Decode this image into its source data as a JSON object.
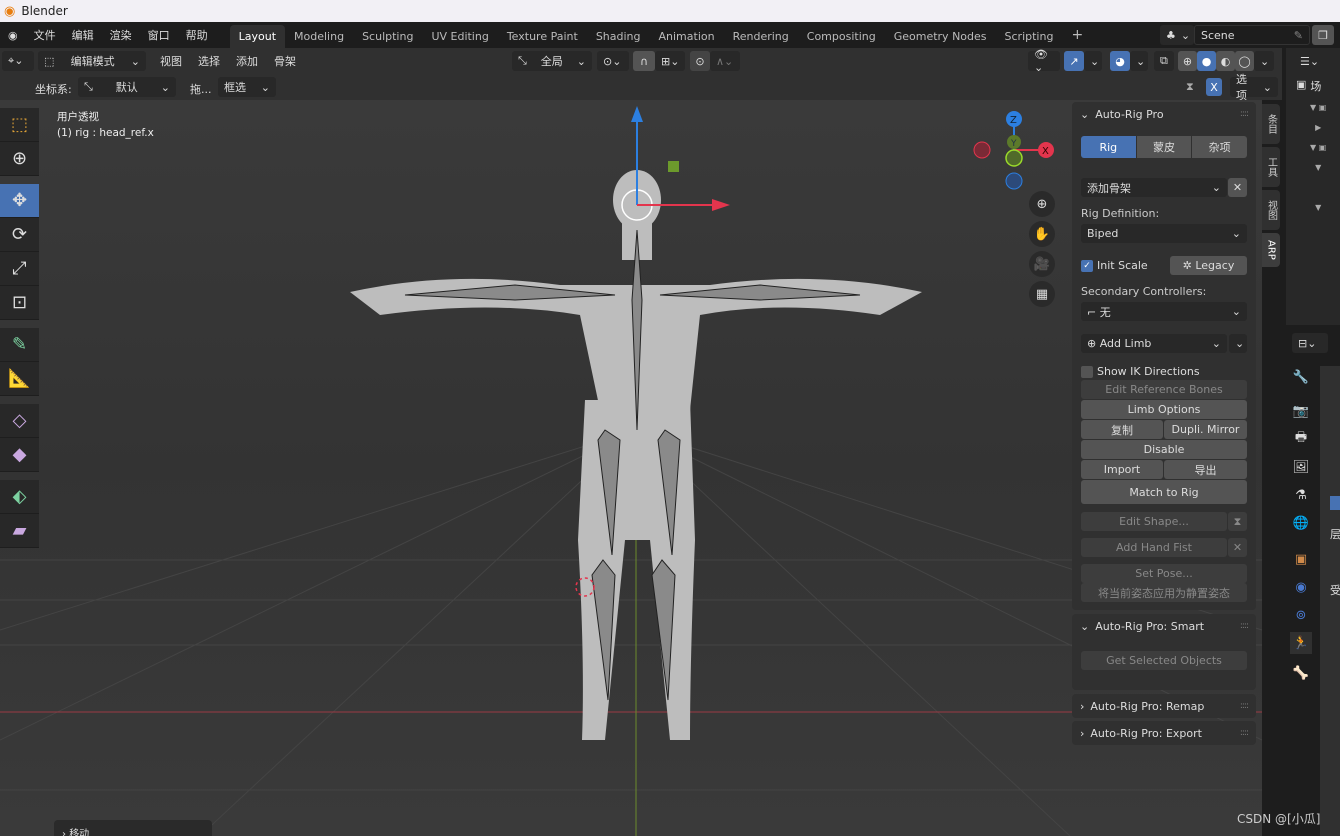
{
  "app": {
    "title": "Blender"
  },
  "menu": [
    "文件",
    "编辑",
    "渲染",
    "窗口",
    "帮助"
  ],
  "workspaces": [
    "Layout",
    "Modeling",
    "Sculpting",
    "UV Editing",
    "Texture Paint",
    "Shading",
    "Animation",
    "Rendering",
    "Compositing",
    "Geometry Nodes",
    "Scripting"
  ],
  "active_workspace": "Layout",
  "scene": {
    "name": "Scene"
  },
  "viewport_header": {
    "mode": "编辑模式",
    "menus": [
      "视图",
      "选择",
      "添加",
      "骨架"
    ],
    "transform_orientation": "全局"
  },
  "tool_header": {
    "coord_label": "坐标系:",
    "coord_value": "默认",
    "drag_label": "拖...",
    "drag_value": "框选",
    "mirror_x": "X",
    "options": "选项"
  },
  "viewport": {
    "view_name": "用户透视",
    "object_info": "(1) rig : head_ref.x",
    "gizmo": {
      "z": "Z",
      "y": "Y",
      "x": "X"
    },
    "last_op": "移动"
  },
  "sidebar_tabs": [
    "条目",
    "工具",
    "视图",
    "ARP"
  ],
  "arp": {
    "title": "Auto-Rig Pro",
    "tabs": [
      "Rig",
      "蒙皮",
      "杂项"
    ],
    "active_tab": "Rig",
    "add_armature": "添加骨架",
    "rig_def_label": "Rig Definition:",
    "rig_def": "Biped",
    "init_scale": "Init Scale",
    "init_scale_checked": true,
    "legacy": "Legacy",
    "secondary_label": "Secondary Controllers:",
    "secondary_value": "无",
    "add_limb": "Add Limb",
    "show_ik": "Show IK Directions",
    "edit_ref": "Edit Reference Bones",
    "limb_options": "Limb Options",
    "copy": "复制",
    "dupli_mirror": "Dupli. Mirror",
    "disable": "Disable",
    "import": "Import",
    "export": "导出",
    "match": "Match to Rig",
    "edit_shape": "Edit Shape...",
    "hand_fist": "Add Hand Fist",
    "set_pose": "Set Pose...",
    "apply_rest": "将当前姿态应用为静置姿态"
  },
  "smart": {
    "title": "Auto-Rig Pro: Smart",
    "get_selected": "Get Selected Objects"
  },
  "remap": {
    "title": "Auto-Rig Pro: Remap"
  },
  "export_panel": {
    "title": "Auto-Rig Pro: Export"
  },
  "outliner": {
    "scene_label": "场"
  },
  "props": {
    "labels": [
      "层",
      "受"
    ]
  },
  "watermark": "CSDN @[小瓜]",
  "colors": {
    "accent": "#4772b3",
    "x_axis": "#e3354d",
    "y_axis": "#8bc34a",
    "z_axis": "#2c7fe0"
  }
}
